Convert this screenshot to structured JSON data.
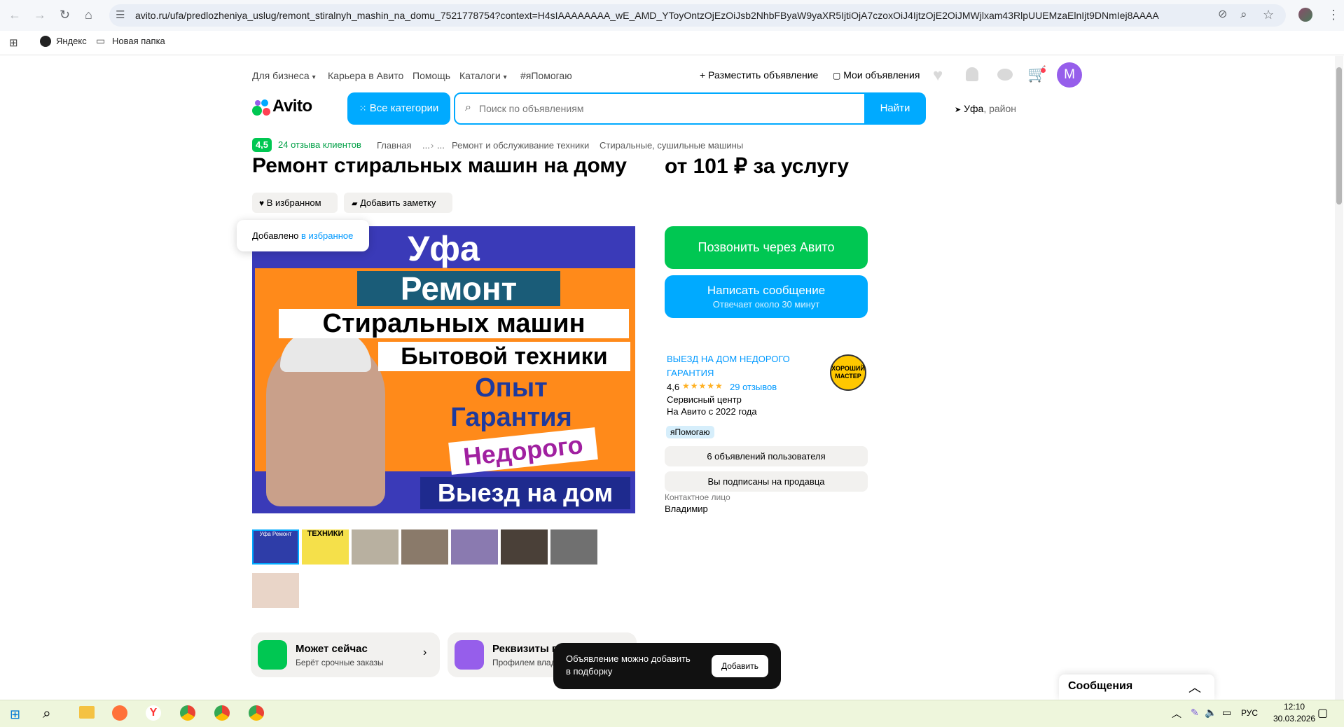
{
  "browser": {
    "url": "avito.ru/ufa/predlozheniya_uslug/remont_stiralnyh_mashin_na_domu_7521778754?context=H4sIAAAAAAAA_wE_AMD_YToyOntzOjEzOiJsb2NhbFByaW9yaXR5IjtiOjA7czoxOiJ4IjtzOjE2OiJMWjlxam43RlpUUEMzaElnIjt9DNmIej8AAAA",
    "bookmarks": [
      "Яндекс",
      "Новая папка"
    ]
  },
  "header": {
    "top_links": [
      "Для бизнеса",
      "Карьера в Авито",
      "Помощь",
      "Каталоги",
      "#яПомогаю"
    ],
    "post_ad": "Разместить объявление",
    "my_ads": "Мои объявления",
    "avatar_letter": "M",
    "logo": "Avito",
    "all_categories": "Все категории",
    "search_placeholder": "Поиск по объявлениям",
    "search_button": "Найти",
    "location_city": "Уфа",
    "location_suffix": ", район"
  },
  "listing": {
    "rating_badge": "4,5",
    "reviews_link": "24 отзыва клиентов",
    "breadcrumbs": [
      "Главная",
      "...",
      "...",
      "Ремонт и обслуживание техники",
      "Стиральные, сушильные машины"
    ],
    "title": "Ремонт стиральных машин на дому",
    "price": "от 101 ₽ за услугу",
    "favorite_label": "В избранном",
    "note_label": "Добавить заметку",
    "toast_prefix": "Добавлено ",
    "toast_link": "в избранное"
  },
  "photo": {
    "lines": [
      "Уфа",
      "Ремонт",
      "Стиральных машин",
      "Бытовой техники",
      "Опыт",
      "Гарантия",
      "Недорого",
      "Выезд на дом"
    ]
  },
  "thumbnails": [
    {
      "label": "Уфа Ремонт"
    },
    {
      "label": "ТЕХНИКИ"
    },
    {
      "label": ""
    },
    {
      "label": ""
    },
    {
      "label": ""
    },
    {
      "label": ""
    },
    {
      "label": ""
    },
    {
      "label": ""
    }
  ],
  "seller": {
    "call_button": "Позвонить через Авито",
    "message_button": "Написать сообщение",
    "message_sub": "Отвечает около 30 минут",
    "name_line1": "ВЫЕЗД НА ДОМ НЕДОРОГО",
    "name_line2": "ГАРАНТИЯ",
    "rating": "4,6",
    "stars": 4.5,
    "reviews": "29 отзывов",
    "type": "Сервисный центр",
    "since": "На Авито с 2022 года",
    "tag": "яПомогаю",
    "badge_text": "ХОРОШИЙ МАСТЕР",
    "user_ads": "6 объявлений пользователя",
    "subscribed": "Вы подписаны на продавца",
    "contact_label": "Контактное лицо",
    "contact_name": "Владимир"
  },
  "cards": [
    {
      "title": "Может сейчас",
      "sub": "Берёт срочные заказы"
    },
    {
      "title": "Реквизиты п",
      "sub": "Профилем влад"
    }
  ],
  "bottom_toast": {
    "line1": "Объявление можно добавить",
    "line2": "в подборку",
    "button": "Добавить"
  },
  "messages_bar": {
    "label": "Сообщения"
  },
  "taskbar": {
    "lang": "РУС",
    "time": "12:10",
    "date": "30.03.2026"
  },
  "colors": {
    "avito_blue": "#00aaff",
    "avito_green": "#00c752",
    "avatar_purple": "#965eeb",
    "tag_bg": "#d6eefb"
  }
}
